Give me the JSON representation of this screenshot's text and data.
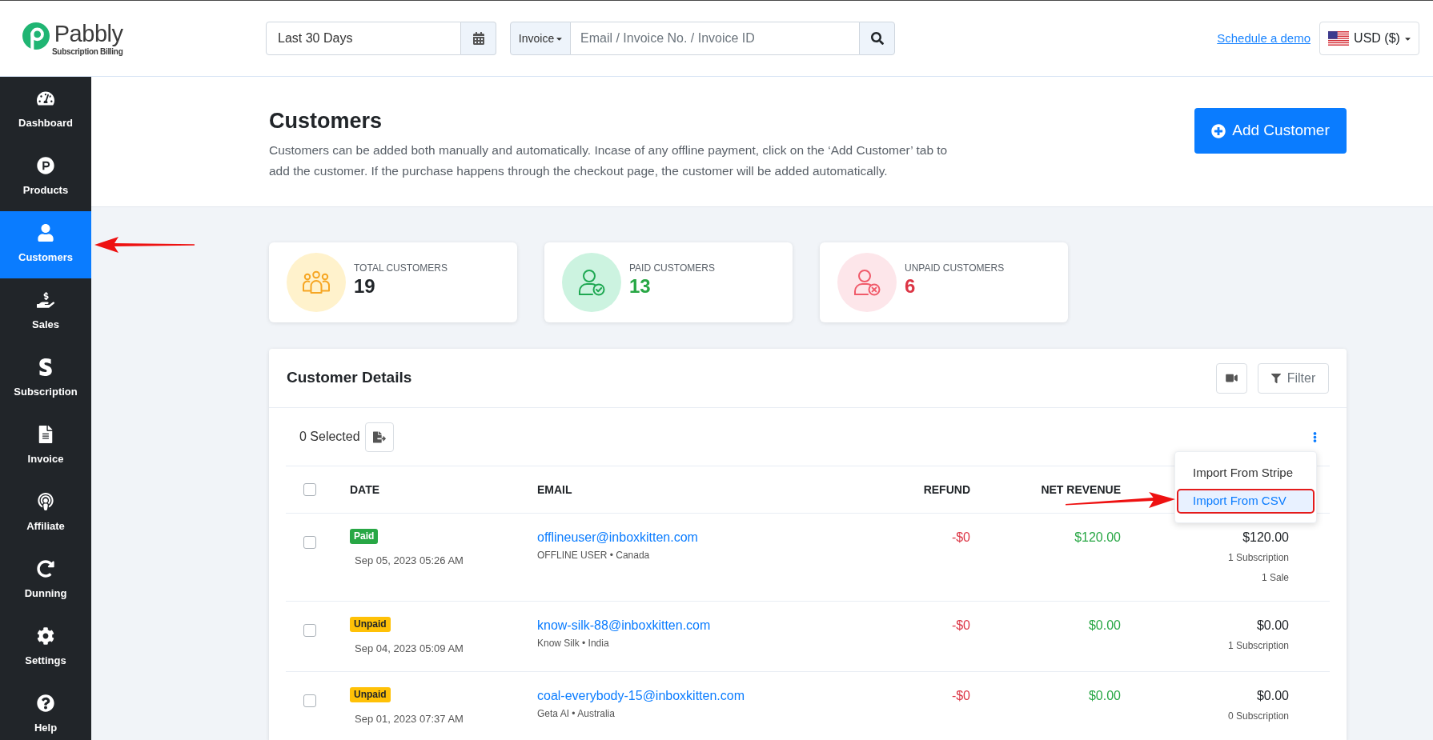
{
  "header": {
    "logo": {
      "name": "Pabbly",
      "tagline": "Subscription Billing"
    },
    "date_range": {
      "value": "Last 30 Days"
    },
    "search": {
      "scope": "Invoice",
      "placeholder": "Email / Invoice No. / Invoice ID"
    },
    "demo_link": "Schedule a demo",
    "currency": "USD ($)"
  },
  "sidebar": {
    "items": [
      {
        "label": "Dashboard",
        "selected": false
      },
      {
        "label": "Products",
        "selected": false
      },
      {
        "label": "Customers",
        "selected": true
      },
      {
        "label": "Sales",
        "selected": false
      },
      {
        "label": "Subscription",
        "selected": false
      },
      {
        "label": "Invoice",
        "selected": false
      },
      {
        "label": "Affiliate",
        "selected": false
      },
      {
        "label": "Dunning",
        "selected": false
      },
      {
        "label": "Settings",
        "selected": false
      },
      {
        "label": "Help",
        "selected": false
      }
    ]
  },
  "page": {
    "title": "Customers",
    "description": "Customers can be added both manually and automatically. Incase of any offline payment, click on the ‘Add Customer’ tab to add the customer. If the purchase happens through the checkout page, the customer will be added automatically.",
    "add_button": "Add Customer"
  },
  "stats": [
    {
      "kind": "total",
      "label": "TOTAL CUSTOMERS",
      "value": "19"
    },
    {
      "kind": "paid",
      "label": "PAID CUSTOMERS",
      "value": "13"
    },
    {
      "kind": "unpaid",
      "label": "UNPAID CUSTOMERS",
      "value": "6"
    }
  ],
  "customer_details": {
    "title": "Customer Details",
    "filter_button": "Filter",
    "selected_count": "0 Selected",
    "menu": {
      "items": [
        {
          "label": "Import From Stripe",
          "selected": false,
          "callout": false
        },
        {
          "label": "Import From CSV",
          "selected": true,
          "callout": true
        }
      ]
    },
    "table": {
      "select_all": {
        "checked": false
      },
      "columns": [
        "DATE",
        "EMAIL",
        "REFUND",
        "NET REVENUE"
      ],
      "rows": [
        {
          "checked": false,
          "badge": {
            "kind": "paid",
            "label": "Paid"
          },
          "date": "Sep 05, 2023 05:26 AM",
          "email": "offlineuser@inboxkitten.com",
          "details": "OFFLINE USER • Canada",
          "refund": "-$0",
          "net_revenue": "$120.00",
          "total": "$120.00",
          "notes": [
            "1 Subscription",
            "1 Sale"
          ]
        },
        {
          "checked": false,
          "badge": {
            "kind": "unpaid",
            "label": "Unpaid"
          },
          "date": "Sep 04, 2023 05:09 AM",
          "email": "know-silk-88@inboxkitten.com",
          "details": "Know Silk • India",
          "refund": "-$0",
          "net_revenue": "$0.00",
          "total": "$0.00",
          "notes": [
            "1 Subscription"
          ]
        },
        {
          "checked": false,
          "badge": {
            "kind": "unpaid",
            "label": "Unpaid"
          },
          "date": "Sep 01, 2023 07:37 AM",
          "email": "coal-everybody-15@inboxkitten.com",
          "details": "Geta AI • Australia",
          "refund": "-$0",
          "net_revenue": "$0.00",
          "total": "$0.00",
          "notes": [
            "0 Subscription"
          ]
        }
      ]
    }
  }
}
